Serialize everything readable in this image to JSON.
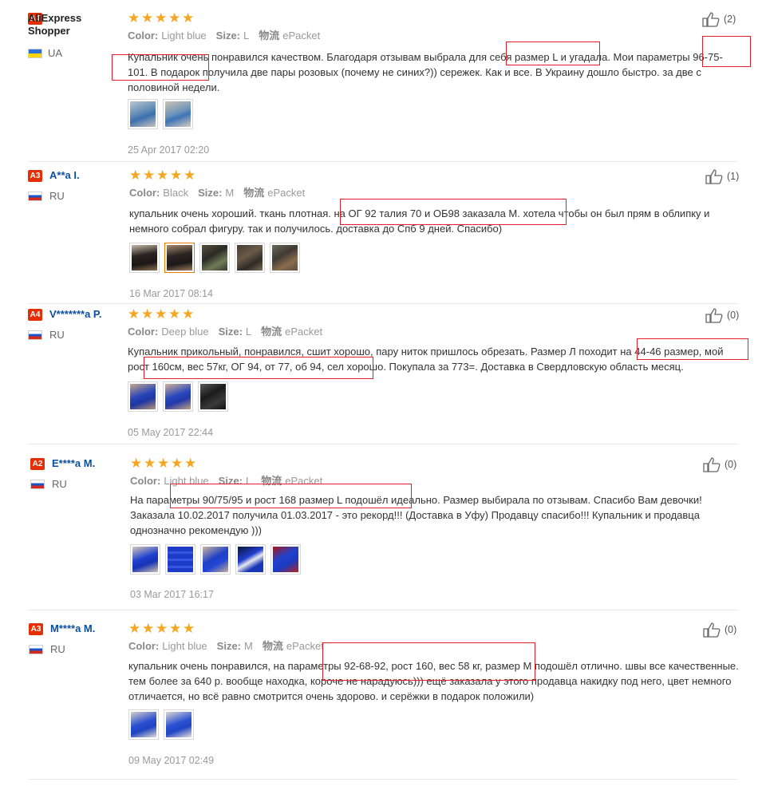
{
  "labels": {
    "color": "Color:",
    "size": "Size:",
    "shipping": "物流"
  },
  "reviews": [
    {
      "badge": "A4",
      "user": "AliExpress Shopper",
      "country": "UA",
      "color": "Light blue",
      "size": "L",
      "shipping": "ePacket",
      "likes": "(2)",
      "text": "Купальник очень понравился качеством. Благодаря отзывам выбрала для себя размер L и угадала. Мои параметры 96-75-101. В подарок получила две пары розовых (почему не синих?)) сережек. Как и все. В Украину дошло быстро. за две с половиной недели.",
      "date": "25 Apr 2017 02:20"
    },
    {
      "badge": "A3",
      "user": "A**a I.",
      "country": "RU",
      "color": "Black",
      "size": "M",
      "shipping": "ePacket",
      "likes": "(1)",
      "text": "купальник очень хороший. ткань плотная. на ОГ 92 талия 70 и ОБ98 заказала М. хотела чтобы он был прям в облипку и немного собрал фигуру. так и получилось. доставка до Спб 9 дней. Спасибо)",
      "date": "16 Mar 2017 08:14"
    },
    {
      "badge": "A4",
      "user": "V*******a P.",
      "country": "RU",
      "color": "Deep blue",
      "size": "L",
      "shipping": "ePacket",
      "likes": "(0)",
      "text": "Купальник прикольный, понравился, сшит хорошо, пару ниток пришлось обрезать. Размер Л походит на 44-46 размер, мой рост 160см, вес 57кг, ОГ 94, от 77, об 94, сел хорошо. Покупала за 773=. Доставка в Свердловскую область месяц.",
      "date": "05 May 2017 22:44"
    },
    {
      "badge": "A2",
      "user": "E****a M.",
      "country": "RU",
      "color": "Light blue",
      "size": "L",
      "shipping": "ePacket",
      "likes": "(0)",
      "text": "На параметры 90/75/95 и рост 168 размер L подошёл идеально. Размер выбирала по отзывам. Спасибо Вам девочки! Заказала 10.02.2017 получила 01.03.2017 - это рекорд!!! (Доставка в Уфу) Продавцу спасибо!!! Купальник и продавца однозначно рекомендую )))",
      "date": "03 Mar 2017 16:17"
    },
    {
      "badge": "A3",
      "user": "M****a M.",
      "country": "RU",
      "color": "Light blue",
      "size": "M",
      "shipping": "ePacket",
      "likes": "(0)",
      "text": "купальник очень понравился, на параметры 92-68-92, рост 160, вес 58 кг, размер М подошёл отлично. швы все качественные. тем более за 640 р. вообще находка, короче не нарадуюсь))) ещё заказала у этого продавца накидку под него, цвет немного отличается, но всё равно смотрится очень здорово. и серёжки в подарок положили)",
      "date": "09 May 2017 02:49"
    }
  ],
  "palette": {
    "star": "#f5a623",
    "badge": "#e62e04",
    "link": "#0c4fa0",
    "highlight": "#e0212a"
  }
}
